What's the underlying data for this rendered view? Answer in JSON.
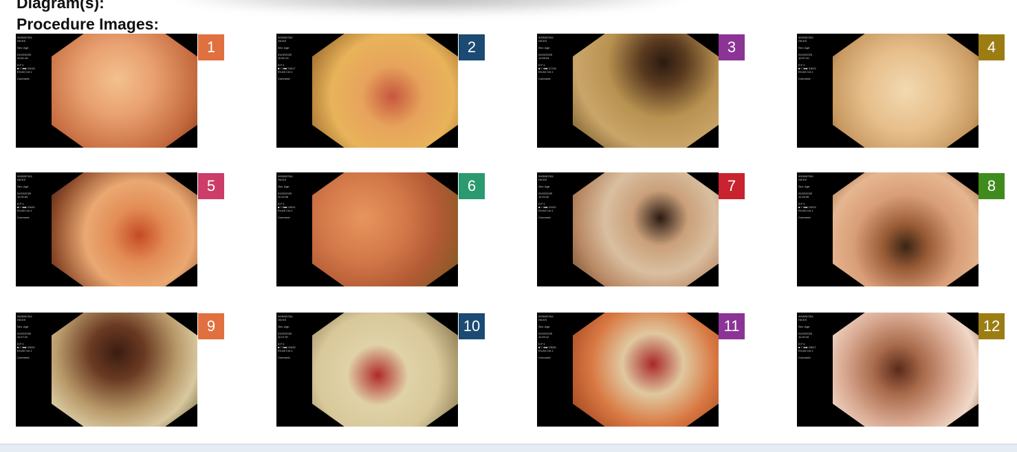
{
  "headings": {
    "diagrams": "Diagram(s):",
    "procedure_images": "Procedure Images:"
  },
  "images": [
    {
      "number": "1",
      "badge_color": "#e0703f",
      "overlay": {
        "line1": "0005287511",
        "line2": "HICKS",
        "line3": "Sex: Age:",
        "line4": "01/02/2025",
        "line5": "10:51:46",
        "line6": "D.F:1",
        "line7": "■□□/■■□16/16",
        "line8": "Eh:A5 Cm:1",
        "line9": "Comment:"
      }
    },
    {
      "number": "2",
      "badge_color": "#1b4a72",
      "overlay": {
        "line1": "0005287511",
        "line2": "HICKS",
        "line3": "Sex: Age:",
        "line4": "01/02/2025",
        "line5": "10:52:15",
        "line6": "D.F:1",
        "line7": "■□□/■■□16/17",
        "line8": "Eh:A5 Cm:1",
        "line9": "Comment:"
      }
    },
    {
      "number": "3",
      "badge_color": "#8c3396",
      "overlay": {
        "line1": "0005287511",
        "line2": "HICKS",
        "line3": "Sex: Age:",
        "line4": "01/02/2025",
        "line5": "10:55:54",
        "line6": "D.F:1",
        "line7": "■□□/■■□17/18",
        "line8": "Eh:A5 Cm:1",
        "line9": "Comment:"
      }
    },
    {
      "number": "4",
      "badge_color": "#9c7d14",
      "overlay": {
        "line1": "0005287511",
        "line2": "HICKS",
        "line3": "Sex: Age:",
        "line4": "01/02/2025",
        "line5": "10:57:20",
        "line6": "D.F:1",
        "line7": "■□□/■■□18/19",
        "line8": "Eh:A5 Cm:1",
        "line9": "Comment:"
      }
    },
    {
      "number": "5",
      "badge_color": "#cc3d6a",
      "overlay": {
        "line1": "0005287511",
        "line2": "HICKS",
        "line3": "Sex: Age:",
        "line4": "01/02/2025",
        "line5": "11:00:53",
        "line6": "D.F:1",
        "line7": "■□□/■■□19/20",
        "line8": "Eh:A5 Cm:1",
        "line9": "Comment:"
      }
    },
    {
      "number": "6",
      "badge_color": "#2b9a6e",
      "overlay": {
        "line1": "0005287511",
        "line2": "HICKS",
        "line3": "Sex: Age:",
        "line4": "01/02/2025",
        "line5": "11:02:06",
        "line6": "D.F:1",
        "line7": "■□□/■■□20/21",
        "line8": "Eh:A5 Cm:1",
        "line9": "Comment:"
      }
    },
    {
      "number": "7",
      "badge_color": "#c8232e",
      "overlay": {
        "line1": "0005287511",
        "line2": "HICKS",
        "line3": "Sex: Age:",
        "line4": "01/02/2025",
        "line5": "11:04:42",
        "line6": "D.F:1",
        "line7": "■□□/■■□21/22",
        "line8": "Eh:A5 Cm:1",
        "line9": "Comment:"
      }
    },
    {
      "number": "8",
      "badge_color": "#3f8c1c",
      "overlay": {
        "line1": "0005287511",
        "line2": "HICKS",
        "line3": "Sex: Age:",
        "line4": "01/02/2025",
        "line5": "11:05:05",
        "line6": "D.F:1",
        "line7": "■□□/■■□22/23",
        "line8": "Eh:A5 Cm:1",
        "line9": "Comment:"
      }
    },
    {
      "number": "9",
      "badge_color": "#e0703f",
      "overlay": {
        "line1": "0005287511",
        "line2": "HICKS",
        "line3": "Sex: Age:",
        "line4": "01/02/2025",
        "line5": "11:07:22",
        "line6": "D.F:1",
        "line7": "■□□/■■□23/24",
        "line8": "Eh:A5 Cm:1",
        "line9": "Comment:"
      }
    },
    {
      "number": "10",
      "badge_color": "#1b4a72",
      "overlay": {
        "line1": "0005287511",
        "line2": "HICKS",
        "line3": "Sex: Age:",
        "line4": "01/02/2025",
        "line5": "11:07:57",
        "line6": "D.F:1",
        "line7": "■□□/■■□24/25",
        "line8": "Eh:A5 Cm:1",
        "line9": "Comment:"
      }
    },
    {
      "number": "11",
      "badge_color": "#8c3396",
      "overlay": {
        "line1": "0005287511",
        "line2": "HICKS",
        "line3": "Sex: Age:",
        "line4": "01/02/2025",
        "line5": "11:09:12",
        "line6": "D.F:1",
        "line7": "■□□/■■□25/26",
        "line8": "Eh:A5 Cm:1",
        "line9": "Comment:"
      }
    },
    {
      "number": "12",
      "badge_color": "#9c7d14",
      "overlay": {
        "line1": "0005287511",
        "line2": "HICKS",
        "line3": "Sex: Age:",
        "line4": "01/02/2025",
        "line5": "11:09:15",
        "line6": "D.F:1",
        "line7": "■□□/■■□26/27",
        "line8": "Eh:A5 Cm:1",
        "line9": "Comment:"
      }
    }
  ]
}
